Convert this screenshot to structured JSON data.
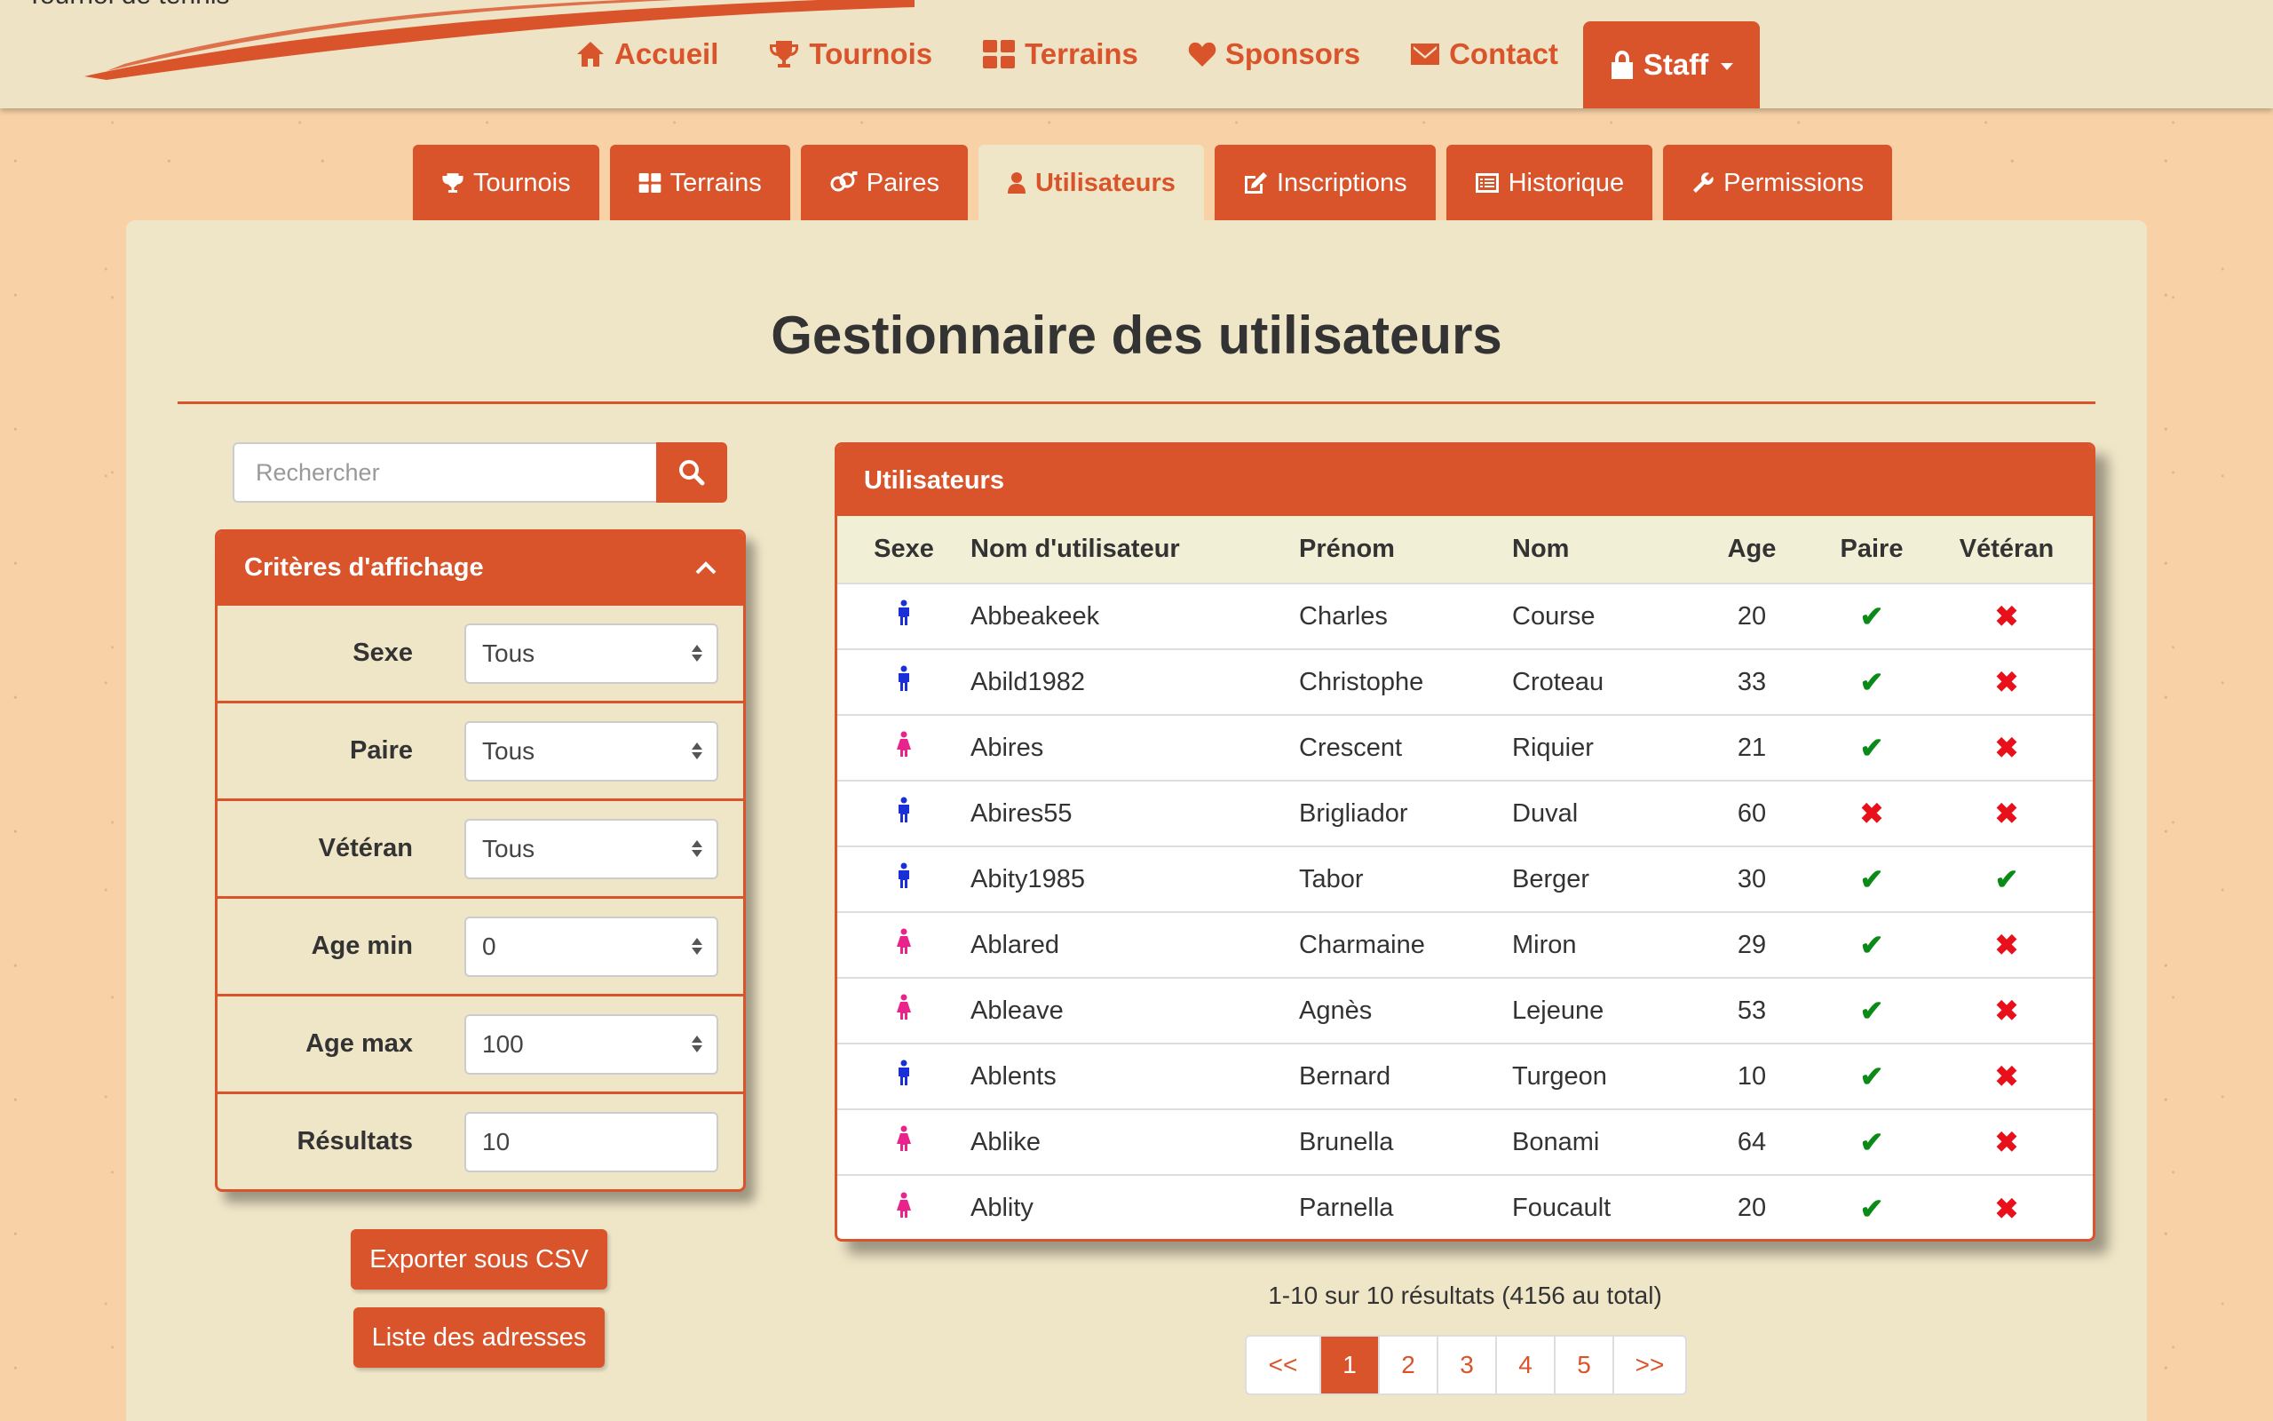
{
  "brand": {
    "title": "Tournoi de tennis"
  },
  "mainnav": [
    {
      "label": "Accueil",
      "icon": "home-icon"
    },
    {
      "label": "Tournois",
      "icon": "trophy-icon"
    },
    {
      "label": "Terrains",
      "icon": "grid-icon"
    },
    {
      "label": "Sponsors",
      "icon": "heart-icon"
    },
    {
      "label": "Contact",
      "icon": "envelope-icon"
    },
    {
      "label": "Staff",
      "icon": "lock-icon"
    }
  ],
  "subtabs": [
    {
      "label": "Tournois",
      "icon": "trophy-icon"
    },
    {
      "label": "Terrains",
      "icon": "grid-icon"
    },
    {
      "label": "Paires",
      "icon": "couple-icon"
    },
    {
      "label": "Utilisateurs",
      "icon": "user-icon",
      "active": true
    },
    {
      "label": "Inscriptions",
      "icon": "edit-icon"
    },
    {
      "label": "Historique",
      "icon": "list-icon"
    },
    {
      "label": "Permissions",
      "icon": "wrench-icon"
    }
  ],
  "page": {
    "title": "Gestionnaire des utilisateurs"
  },
  "search": {
    "placeholder": "Rechercher"
  },
  "filters": {
    "title": "Critères d'affichage",
    "rows": [
      {
        "label": "Sexe",
        "value": "Tous"
      },
      {
        "label": "Paire",
        "value": "Tous"
      },
      {
        "label": "Vétéran",
        "value": "Tous"
      },
      {
        "label": "Age min",
        "value": "0"
      },
      {
        "label": "Age max",
        "value": "100"
      },
      {
        "label": "Résultats",
        "value": "10"
      }
    ]
  },
  "actions": {
    "export_csv": "Exporter sous CSV",
    "addresses": "Liste des adresses"
  },
  "table": {
    "title": "Utilisateurs",
    "headers": [
      "Sexe",
      "Nom d'utilisateur",
      "Prénom",
      "Nom",
      "Age",
      "Paire",
      "Vétéran"
    ],
    "rows": [
      {
        "sexe": "male",
        "username": "Abbeakeek",
        "prenom": "Charles",
        "nom": "Course",
        "age": "20",
        "paire": true,
        "veteran": false
      },
      {
        "sexe": "male",
        "username": "Abild1982",
        "prenom": "Christophe",
        "nom": "Croteau",
        "age": "33",
        "paire": true,
        "veteran": false
      },
      {
        "sexe": "female",
        "username": "Abires",
        "prenom": "Crescent",
        "nom": "Riquier",
        "age": "21",
        "paire": true,
        "veteran": false
      },
      {
        "sexe": "male",
        "username": "Abires55",
        "prenom": "Brigliador",
        "nom": "Duval",
        "age": "60",
        "paire": false,
        "veteran": false
      },
      {
        "sexe": "male",
        "username": "Abity1985",
        "prenom": "Tabor",
        "nom": "Berger",
        "age": "30",
        "paire": true,
        "veteran": true
      },
      {
        "sexe": "female",
        "username": "Ablared",
        "prenom": "Charmaine",
        "nom": "Miron",
        "age": "29",
        "paire": true,
        "veteran": false
      },
      {
        "sexe": "female",
        "username": "Ableave",
        "prenom": "Agnès",
        "nom": "Lejeune",
        "age": "53",
        "paire": true,
        "veteran": false
      },
      {
        "sexe": "male",
        "username": "Ablents",
        "prenom": "Bernard",
        "nom": "Turgeon",
        "age": "10",
        "paire": true,
        "veteran": false
      },
      {
        "sexe": "female",
        "username": "Ablike",
        "prenom": "Brunella",
        "nom": "Bonami",
        "age": "64",
        "paire": true,
        "veteran": false
      },
      {
        "sexe": "female",
        "username": "Ablity",
        "prenom": "Parnella",
        "nom": "Foucault",
        "age": "20",
        "paire": true,
        "veteran": false
      }
    ]
  },
  "summary": "1-10 sur 10 résultats (4156 au total)",
  "pagination": [
    "<<",
    "1",
    "2",
    "3",
    "4",
    "5",
    ">>"
  ],
  "pagination_active": "1",
  "colors": {
    "accent": "#d9542b",
    "male": "#1a2fd6",
    "female": "#e8248c",
    "check": "#0b8a17",
    "cross": "#e8101a"
  },
  "symbols": {
    "check": "✔",
    "cross": "✖"
  }
}
